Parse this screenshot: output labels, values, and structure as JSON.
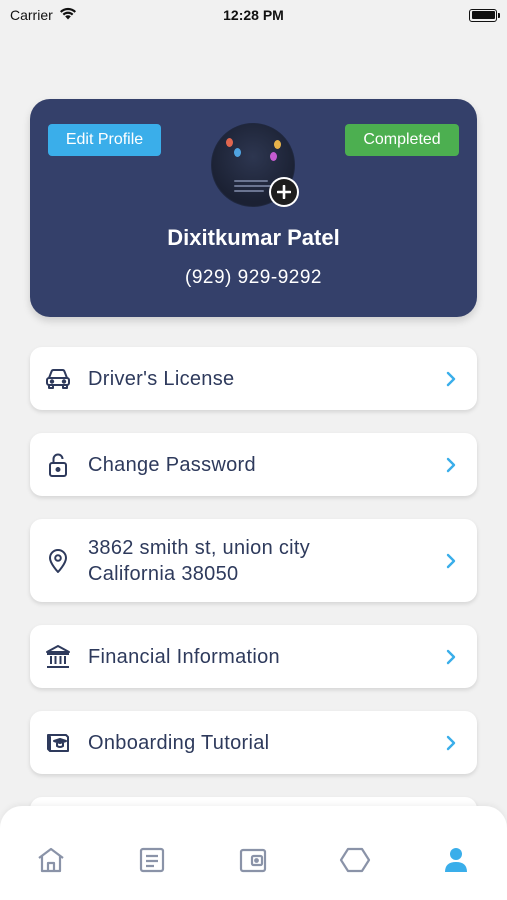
{
  "status_bar": {
    "carrier": "Carrier",
    "time": "12:28 PM"
  },
  "profile": {
    "edit_label": "Edit Profile",
    "status_label": "Completed",
    "name": "Dixitkumar Patel",
    "phone": "(929) 929-9292",
    "colors": {
      "card": "#34406a",
      "edit": "#3aaeea",
      "completed": "#4caf50"
    }
  },
  "menu": [
    {
      "icon": "car-icon",
      "label_lines": [
        "Driver's License"
      ]
    },
    {
      "icon": "lock-icon",
      "label_lines": [
        "Change Password"
      ]
    },
    {
      "icon": "location-pin-icon",
      "label_lines": [
        "3862 smith st, union city",
        "California 38050"
      ]
    },
    {
      "icon": "bank-icon",
      "label_lines": [
        "Financial Information"
      ]
    },
    {
      "icon": "tutorial-icon",
      "label_lines": [
        "Onboarding Tutorial"
      ]
    }
  ],
  "bottom_nav": {
    "items": [
      "home-icon",
      "document-icon",
      "wallet-icon",
      "hexagon-icon",
      "profile-icon"
    ],
    "active": "profile-icon",
    "colors": {
      "inactive": "#8a93a8",
      "active": "#3aaeea"
    }
  }
}
